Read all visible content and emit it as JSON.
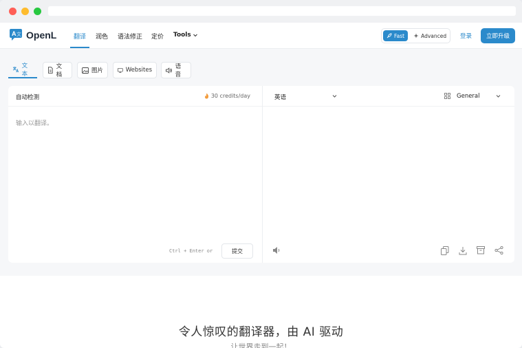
{
  "brand": {
    "name": "OpenL"
  },
  "nav": {
    "items": [
      "翻译",
      "润色",
      "语法修正",
      "定价"
    ],
    "tools_label": "Tools"
  },
  "mode": {
    "fast": "Fast",
    "advanced": "Advanced"
  },
  "auth": {
    "login": "登录",
    "upgrade": "立即升级"
  },
  "tabs": [
    "文本",
    "文档",
    "图片",
    "Websites",
    "语音"
  ],
  "source": {
    "language": "自动检测",
    "credits": "30 credits/day",
    "placeholder": "输入以翻译。",
    "shortcut": "Ctrl + Enter or",
    "submit": "提交"
  },
  "target": {
    "language": "英语",
    "style": "General"
  },
  "hero": {
    "title": "令人惊叹的翻译器，由 AI 驱动",
    "subtitle": "让世界走到一起！"
  },
  "colors": {
    "accent": "#2b8acb"
  }
}
